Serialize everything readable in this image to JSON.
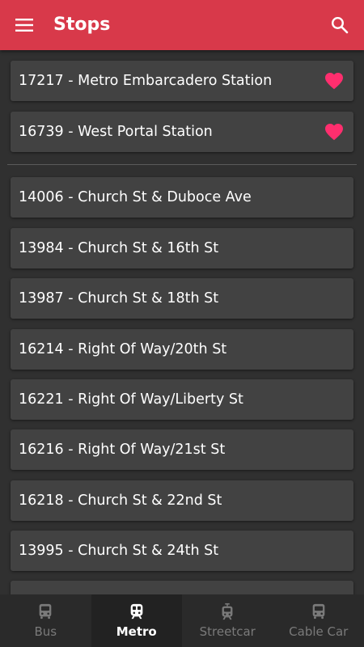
{
  "appbar": {
    "title": "Stops",
    "color": "#d8394a",
    "menu_icon": "menu-icon",
    "search_icon": "search-icon"
  },
  "favorites": [
    {
      "label": "17217 - Metro Embarcadero Station",
      "favorite": true
    },
    {
      "label": "16739 - West Portal Station",
      "favorite": true
    }
  ],
  "stops": [
    {
      "label": "14006 - Church St & Duboce Ave"
    },
    {
      "label": "13984 - Church St & 16th St"
    },
    {
      "label": "13987 - Church St & 18th St"
    },
    {
      "label": "16214 - Right Of Way/20th St"
    },
    {
      "label": "16221 - Right Of Way/Liberty St"
    },
    {
      "label": "16216 - Right Of Way/21st St"
    },
    {
      "label": "16218 - Church St & 22nd St"
    },
    {
      "label": "13995 - Church St & 24th St"
    },
    {
      "label": ""
    }
  ],
  "bottom_nav": {
    "items": [
      {
        "label": "Bus",
        "icon": "bus-icon",
        "active": false
      },
      {
        "label": "Metro",
        "icon": "train-icon",
        "active": true
      },
      {
        "label": "Streetcar",
        "icon": "tram-icon",
        "active": false
      },
      {
        "label": "Cable Car",
        "icon": "cable-car-icon",
        "active": false
      }
    ]
  },
  "colors": {
    "background": "#303030",
    "card": "#424242",
    "heart": "#ff2e6e",
    "nav_inactive": "#7a7a7a",
    "nav_active": "#ffffff"
  }
}
